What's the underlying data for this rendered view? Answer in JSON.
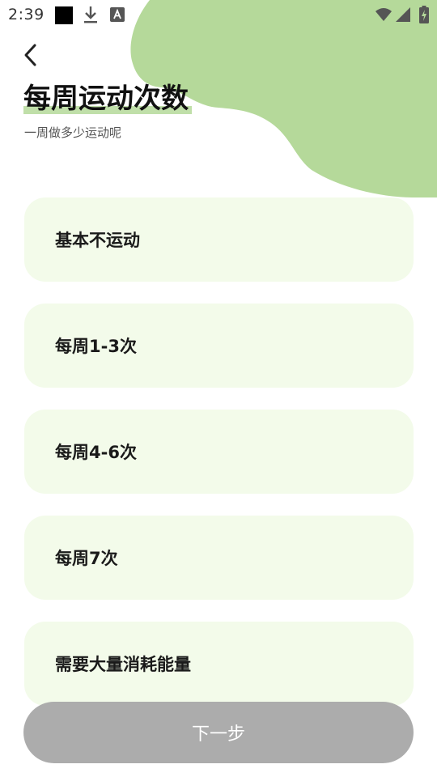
{
  "status_bar": {
    "time": "2:39",
    "icons": [
      "notification-square-icon",
      "download-icon",
      "a-badge-icon",
      "wifi-icon",
      "signal-icon",
      "battery-charging-icon"
    ]
  },
  "header": {
    "back_icon": "chevron-left-icon",
    "title": "每周运动次数",
    "subtitle": "一周做多少运动呢"
  },
  "options": [
    {
      "label": "基本不运动"
    },
    {
      "label": "每周1-3次"
    },
    {
      "label": "每周4-6次"
    },
    {
      "label": "每周7次"
    },
    {
      "label": "需要大量消耗能量"
    }
  ],
  "footer": {
    "next_label": "下一步"
  },
  "colors": {
    "accent_blob": "#b5d99a",
    "option_background": "#f3fbea",
    "next_button_disabled": "#acacac"
  }
}
